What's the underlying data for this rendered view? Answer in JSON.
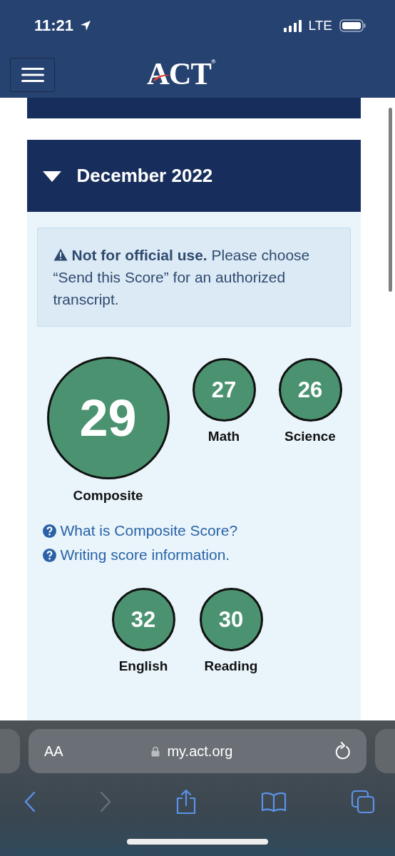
{
  "status_bar": {
    "time": "11:21",
    "network": "LTE"
  },
  "header": {
    "logo": "ACT$^{®}$"
  },
  "section": {
    "title": "December 2022",
    "expanded": true
  },
  "alert": {
    "text": "**Not for official use.** Please choose “Send this Score” for an authorized transcript."
  },
  "top_scores": [
    {
      "kind": "large",
      "value": "29",
      "label": "Composite"
    },
    {
      "kind": "small",
      "value": "27",
      "label": "Math"
    },
    {
      "kind": "small",
      "value": "26",
      "label": "Science"
    }
  ],
  "links": [
    "What is Composite Score?",
    "Writing score information."
  ],
  "bottom_scores": [
    {
      "value": "32",
      "label": "English"
    },
    {
      "value": "30",
      "label": "Reading"
    }
  ],
  "browser": {
    "text_size": "AA",
    "url": "my.act.org"
  }
}
